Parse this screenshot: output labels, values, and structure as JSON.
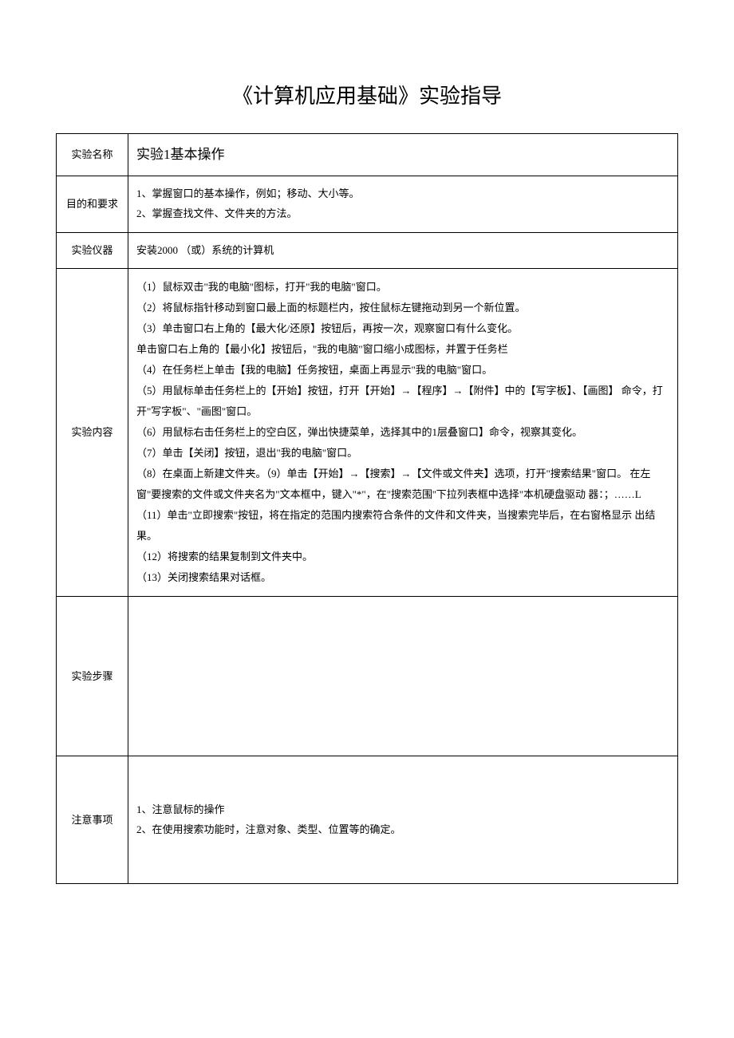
{
  "title": "《计算机应用基础》实验指导",
  "rows": {
    "name_label": "实验名称",
    "name_value": "实验1基本操作",
    "purpose_label": "目的和要求",
    "purpose_line1": "1、掌握窗口的基本操作，例如；移动、大小等。",
    "purpose_line2": "2、掌握查找文件、文件夹的方法。",
    "equipment_label": "实验仪器",
    "equipment_value": "安装2000 （或）系统的计算机",
    "content_label": "实验内容",
    "content_line1": "（1）鼠标双击\"我的电脑\"图标，打开\"我的电脑\"窗口。",
    "content_line2": "（2）将鼠标指针移动到窗口最上面的标题栏内，按住鼠标左键拖动到另一个新位置。",
    "content_line3": "（3）单击窗口右上角的【最大化/还原】按钮后，再按一次，观察窗口有什么变化。",
    "content_line4": "单击窗口右上角的【最小化】按钮后，\"我的电脑\"窗口缩小成图标，并置于任务栏",
    "content_line5": "（4）在任务栏上单击【我的电脑】任务按钮，桌面上再显示\"我的电脑\"窗口。",
    "content_line6": "（5）用鼠标单击任务栏上的【开始】按钮，打开【开始】→【程序】→【附件】中的【写字板】、【画图】 命令，打开\"写字板\"、\"画图\"窗口。",
    "content_line7": "（6）用鼠标右击任务栏上的空白区，弹出快捷菜单，选择其中的1层叠窗口】命令，视察其变化。",
    "content_line8": "（7）单击【关闭】按钮，退出\"我的电脑\"窗口。",
    "content_line9": "（8）在桌面上新建文件夹。（9）单击【开始】→【搜索】→【文件或文件夹】选项，打开\"搜索结果\"窗口。 在左窗\"要搜索的文件或文件夹名为\"文本框中，键入\"*\"，在\"搜索范围''下拉列表框中选择\"本机硬盘驱动 器：；……L",
    "content_line10": "（11）单击\"立即搜索\"按钮，将在指定的范围内搜索符合条件的文件和文件夹，当搜索完毕后，在右窗格显示 出结果。",
    "content_line11": "（12）将搜索的结果复制到文件夹中。",
    "content_line12": "（13）关闭搜索结果对话框。",
    "steps_label": "实验步骤",
    "steps_value": "",
    "notice_label": "注意事项",
    "notice_line1": "1、注意鼠标的操作",
    "notice_line2": "2、在使用搜索功能时，注意对象、类型、位置等的确定。"
  }
}
